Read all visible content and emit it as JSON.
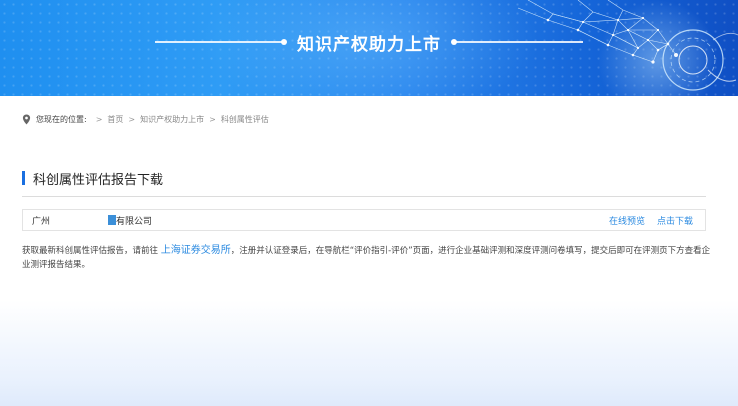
{
  "banner": {
    "title": "知识产权助力上市"
  },
  "breadcrumb": {
    "label": "您现在的位置:",
    "items": [
      "首页",
      "知识产权助力上市",
      "科创属性评估"
    ],
    "separator": ">"
  },
  "section": {
    "title": "科创属性评估报告下载"
  },
  "file": {
    "name_prefix": "广州",
    "name_suffix": "有限公司",
    "preview_label": "在线预览",
    "download_label": "点击下载"
  },
  "description": {
    "part1": "获取最新科创属性评估报告，请前往 ",
    "link": "上海证券交易所",
    "part2": "，注册并认证登录后，在导航栏“评价指引-评价”页面，进行企业基础评测和深度评测问卷填写，提交后即可在评测页下方查看企业测评报告结果。"
  },
  "colors": {
    "accent": "#1a6fe0",
    "link": "#2b8ae0",
    "banner_start": "#1f8ff0",
    "banner_end": "#0f4fc4"
  }
}
